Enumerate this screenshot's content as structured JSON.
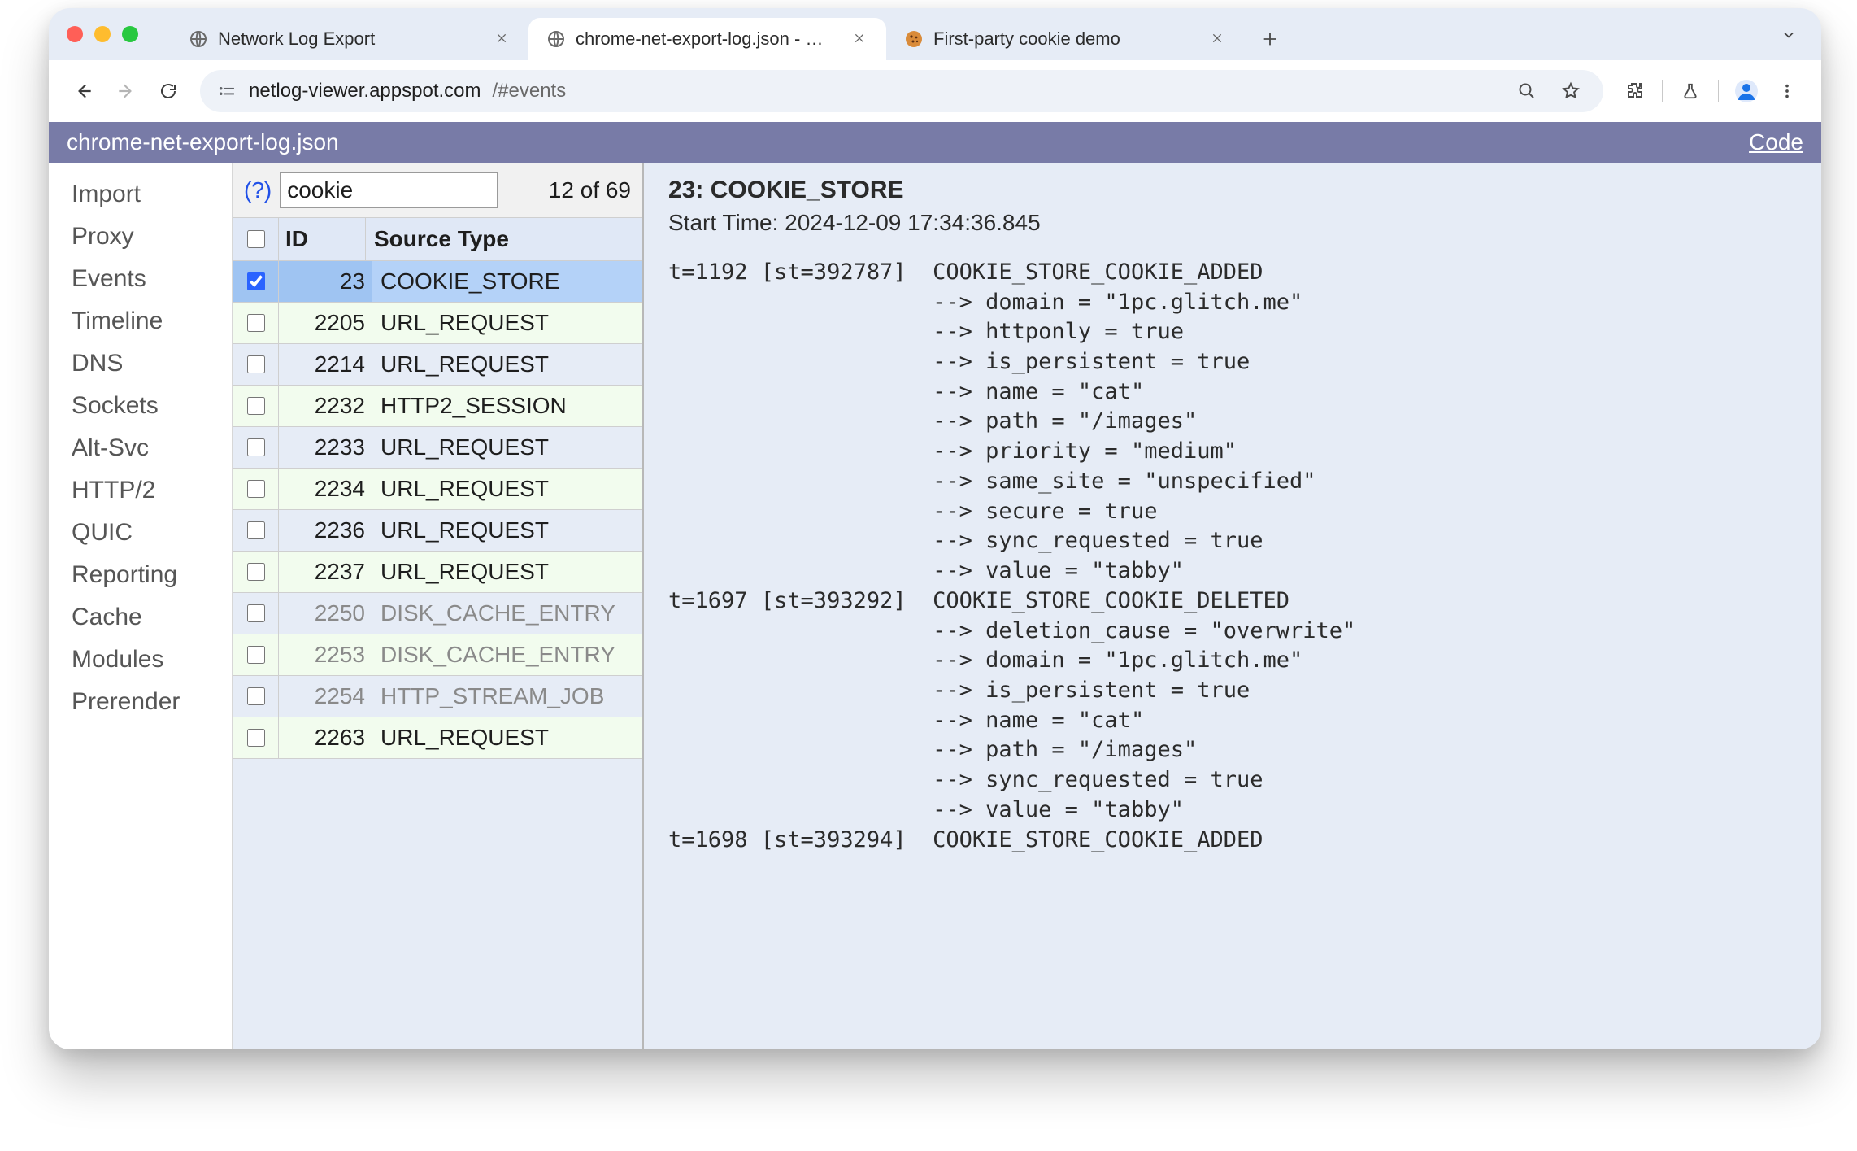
{
  "chrome": {
    "tabs": [
      {
        "label": "Network Log Export",
        "favicon": "globe-icon",
        "active": false
      },
      {
        "label": "chrome-net-export-log.json - …",
        "favicon": "globe-icon",
        "active": true
      },
      {
        "label": "First-party cookie demo",
        "favicon": "cookie-icon",
        "active": false
      }
    ],
    "url_host": "netlog-viewer.appspot.com",
    "url_path": "/#events"
  },
  "app": {
    "header_title": "chrome-net-export-log.json",
    "header_right": "Code",
    "sidebar": [
      "Import",
      "Proxy",
      "Events",
      "Timeline",
      "DNS",
      "Sockets",
      "Alt-Svc",
      "HTTP/2",
      "QUIC",
      "Reporting",
      "Cache",
      "Modules",
      "Prerender"
    ],
    "filter": {
      "help_label": "(?)",
      "value": "cookie",
      "count": "12 of 69",
      "id_header": "ID",
      "type_header": "Source Type"
    },
    "events": [
      {
        "id": "23",
        "type": "COOKIE_STORE",
        "selected": true,
        "checked": true,
        "dim": false,
        "alt": false
      },
      {
        "id": "2205",
        "type": "URL_REQUEST",
        "dim": false,
        "alt": true
      },
      {
        "id": "2214",
        "type": "URL_REQUEST",
        "dim": false,
        "alt": false
      },
      {
        "id": "2232",
        "type": "HTTP2_SESSION",
        "dim": false,
        "alt": true
      },
      {
        "id": "2233",
        "type": "URL_REQUEST",
        "dim": false,
        "alt": false
      },
      {
        "id": "2234",
        "type": "URL_REQUEST",
        "dim": false,
        "alt": true
      },
      {
        "id": "2236",
        "type": "URL_REQUEST",
        "dim": false,
        "alt": false
      },
      {
        "id": "2237",
        "type": "URL_REQUEST",
        "dim": false,
        "alt": true
      },
      {
        "id": "2250",
        "type": "DISK_CACHE_ENTRY",
        "dim": true,
        "alt": false
      },
      {
        "id": "2253",
        "type": "DISK_CACHE_ENTRY",
        "dim": true,
        "alt": true
      },
      {
        "id": "2254",
        "type": "HTTP_STREAM_JOB",
        "dim": true,
        "alt": false
      },
      {
        "id": "2263",
        "type": "URL_REQUEST",
        "dim": false,
        "alt": true
      }
    ],
    "detail": {
      "title_id": "23",
      "title_type": "COOKIE_STORE",
      "start_time_label": "Start Time: ",
      "start_time": "2024-12-09 17:34:36.845",
      "log": "t=1192 [st=392787]  COOKIE_STORE_COOKIE_ADDED\n                    --> domain = \"1pc.glitch.me\"\n                    --> httponly = true\n                    --> is_persistent = true\n                    --> name = \"cat\"\n                    --> path = \"/images\"\n                    --> priority = \"medium\"\n                    --> same_site = \"unspecified\"\n                    --> secure = true\n                    --> sync_requested = true\n                    --> value = \"tabby\"\nt=1697 [st=393292]  COOKIE_STORE_COOKIE_DELETED\n                    --> deletion_cause = \"overwrite\"\n                    --> domain = \"1pc.glitch.me\"\n                    --> is_persistent = true\n                    --> name = \"cat\"\n                    --> path = \"/images\"\n                    --> sync_requested = true\n                    --> value = \"tabby\"\nt=1698 [st=393294]  COOKIE_STORE_COOKIE_ADDED"
    }
  }
}
